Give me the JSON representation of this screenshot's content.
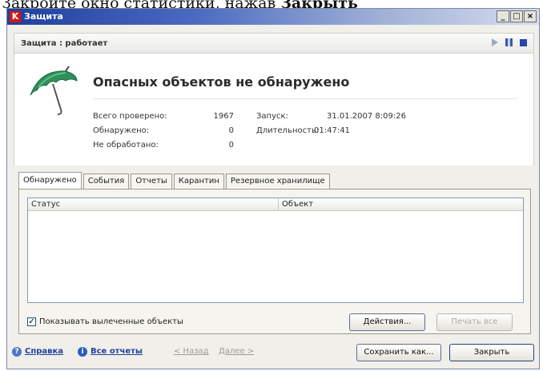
{
  "caption": {
    "text": "Закройте окно статистики, нажав ",
    "bold": "Закрыть"
  },
  "window": {
    "title": "Защита",
    "buttons": {
      "minimize": "_",
      "maximize": "□",
      "close": "×"
    }
  },
  "status": {
    "text": "Защита : работает"
  },
  "summary": {
    "headline": "Опасных объектов не обнаружено",
    "stats": [
      {
        "label": "Всего проверено:",
        "value": "1967"
      },
      {
        "label": "Обнаружено:",
        "value": "0"
      },
      {
        "label": "Не обработано:",
        "value": "0"
      }
    ],
    "start_label": "Запуск:",
    "start_value": "31.01.2007 8:09:26",
    "duration_label": "Длительность:",
    "duration_value": "01:47:41"
  },
  "tabs": [
    "Обнаружено",
    "События",
    "Отчеты",
    "Карантин",
    "Резервное хранилище"
  ],
  "table": {
    "columns": [
      "Статус",
      "Объект"
    ]
  },
  "options": {
    "show_cured_label": "Показывать вылеченные объекты",
    "show_cured_checked": "✓"
  },
  "panel_buttons": {
    "actions": "Действия...",
    "print_all": "Печать все"
  },
  "footer": {
    "help": "Справка",
    "all_reports": "Все отчеты",
    "back": "< Назад",
    "next": "Далее >",
    "save_as": "Сохранить как...",
    "close": "Закрыть"
  }
}
